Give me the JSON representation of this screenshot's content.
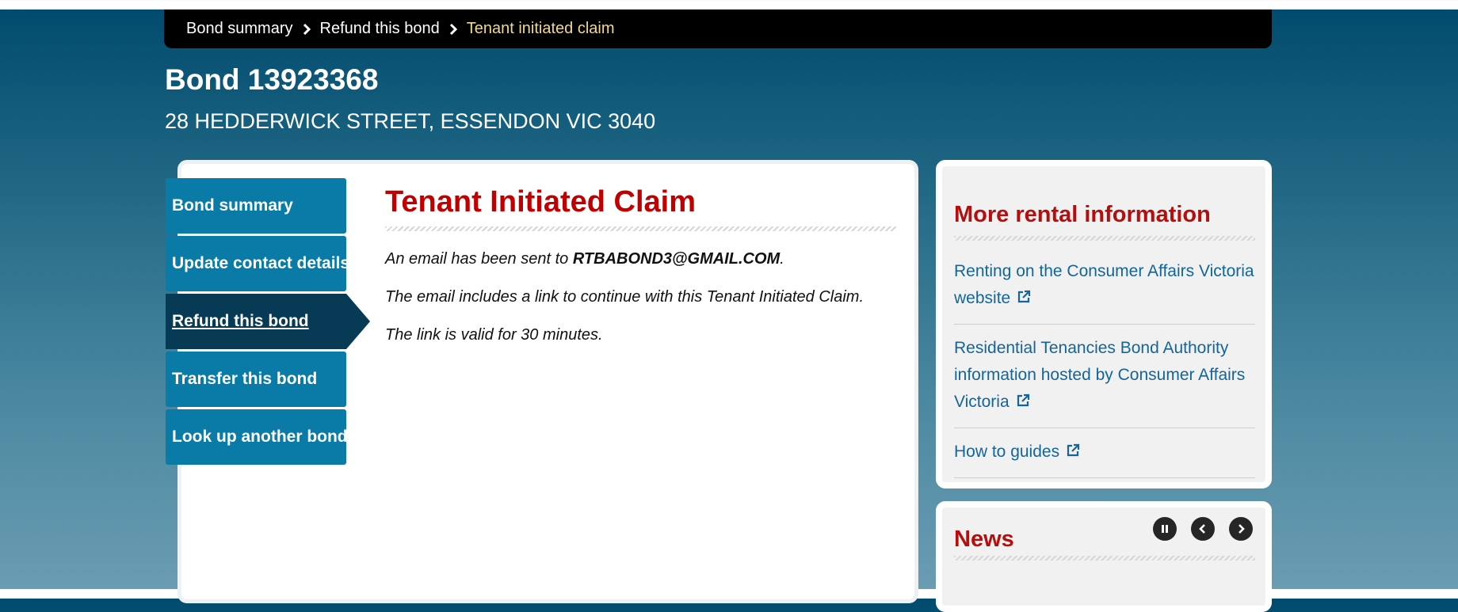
{
  "breadcrumb": {
    "items": [
      {
        "label": "Bond summary"
      },
      {
        "label": "Refund this bond"
      },
      {
        "label": "Tenant initiated claim"
      }
    ]
  },
  "header": {
    "title": "Bond 13923368",
    "address": "28 HEDDERWICK STREET, ESSENDON VIC 3040"
  },
  "sidebar": {
    "items": [
      {
        "label": "Bond summary"
      },
      {
        "label": "Update contact details"
      },
      {
        "label": "Refund this bond",
        "active": true
      },
      {
        "label": "Transfer this bond"
      },
      {
        "label": "Look up another bond"
      }
    ]
  },
  "main": {
    "heading": "Tenant Initiated Claim",
    "message_prefix": "An email has been sent to ",
    "email": "RTBABOND3@GMAIL.COM",
    "message_suffix": ".",
    "paragraph2": "The email includes a link to continue with this Tenant Initiated Claim.",
    "paragraph3": "The link is valid for 30 minutes."
  },
  "rental_info": {
    "heading": "More rental information",
    "links": [
      {
        "label": "Renting on the Consumer Affairs Victoria website",
        "icon": "external-link-icon"
      },
      {
        "label": "Residential Tenancies Bond Authority information hosted by Consumer Affairs Victoria",
        "icon": "external-link-icon"
      },
      {
        "label": "How to guides",
        "icon": "external-link-icon"
      }
    ]
  },
  "news": {
    "heading": "News",
    "controls": [
      "pause-icon",
      "chevron-left-icon",
      "chevron-right-icon"
    ]
  },
  "colors": {
    "nav_blue": "#0a7aa7",
    "nav_active": "#063a55",
    "heading_red": "#c00000",
    "link_blue": "#14659a",
    "breadcrumb_current": "#f3d98a"
  }
}
